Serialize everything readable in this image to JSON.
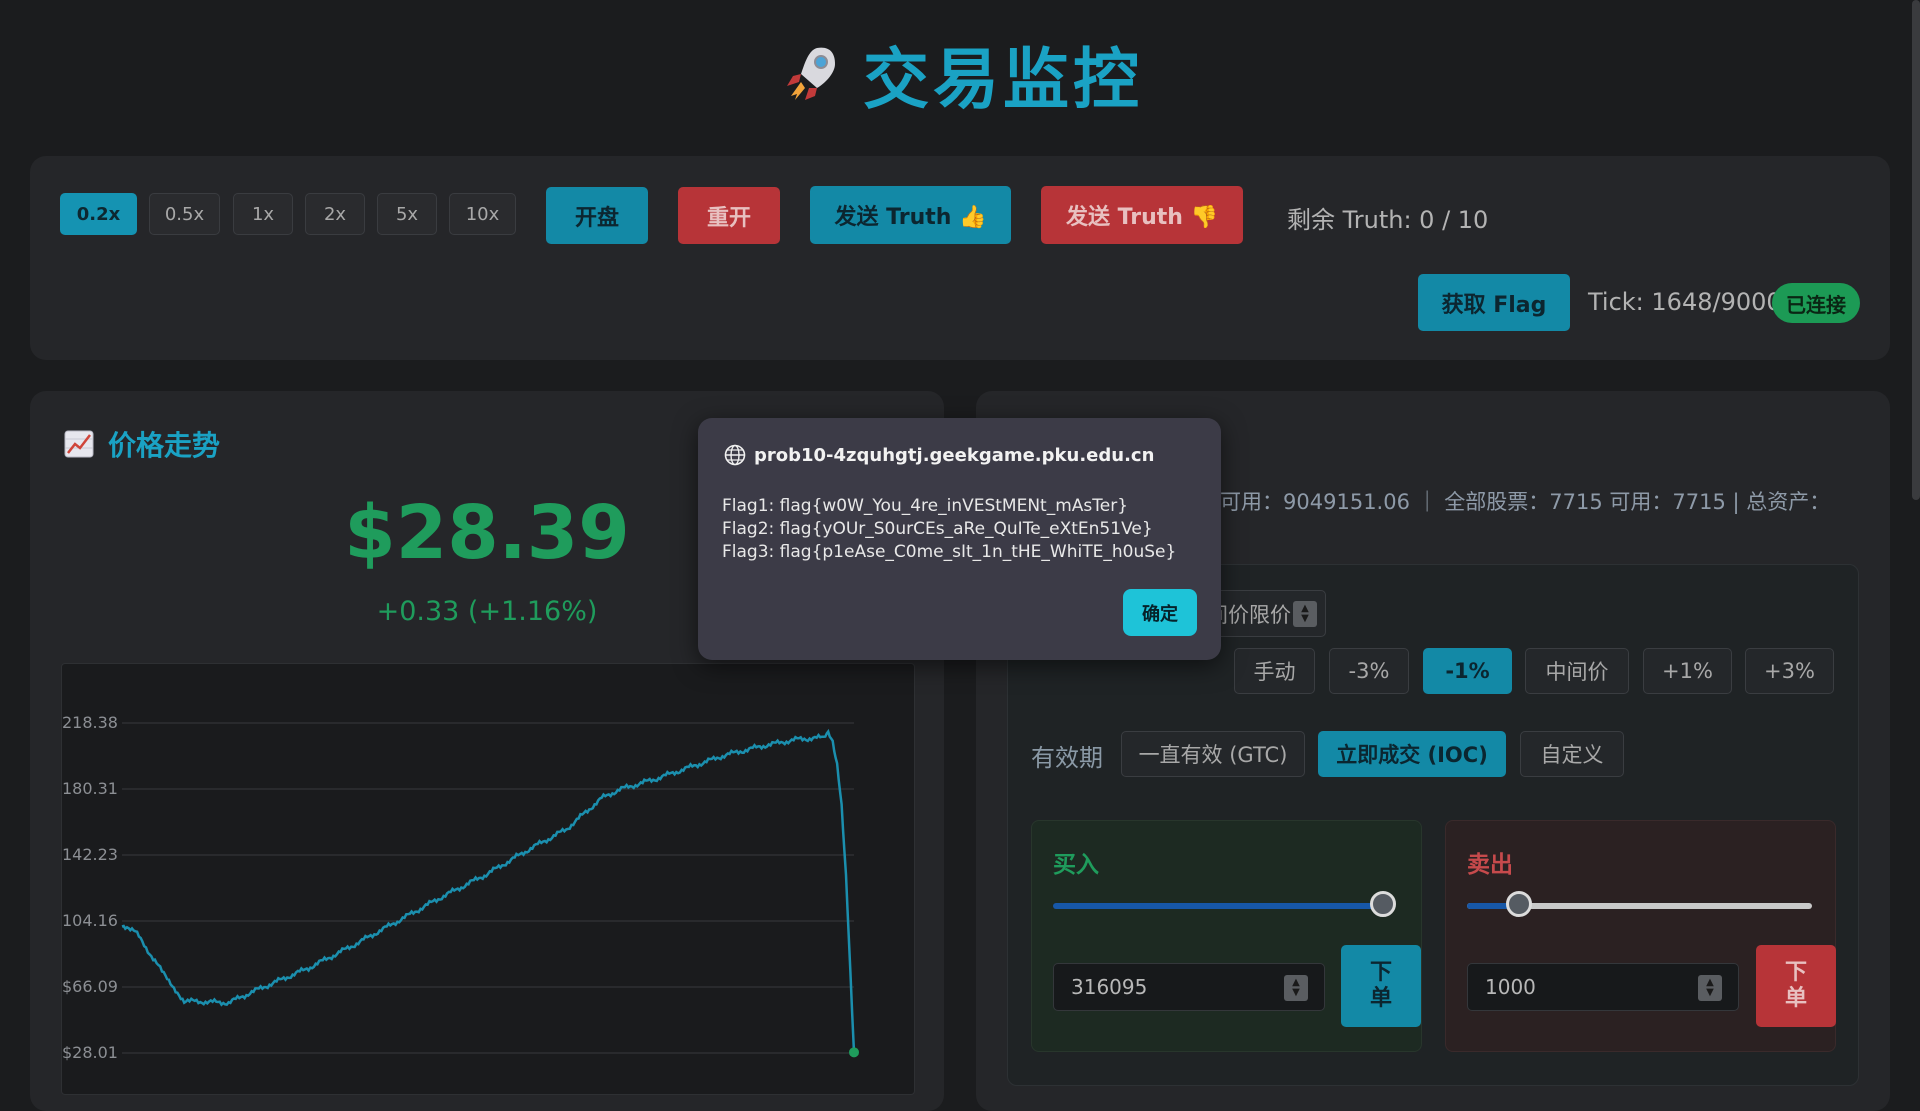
{
  "header": {
    "icon": "rocket-icon",
    "title": "交易监控"
  },
  "controls": {
    "speeds": [
      {
        "label": "0.2x",
        "active": true
      },
      {
        "label": "0.5x",
        "active": false
      },
      {
        "label": "1x",
        "active": false
      },
      {
        "label": "2x",
        "active": false
      },
      {
        "label": "5x",
        "active": false
      },
      {
        "label": "10x",
        "active": false
      }
    ],
    "open_label": "开盘",
    "restart_label": "重开",
    "send_truth_up_label": "发送 Truth 👍",
    "send_truth_down_label": "发送 Truth 👎",
    "remaining_truth": "剩余 Truth: 0 / 10",
    "get_flag_label": "获取 Flag",
    "tick": "Tick: 1648/9000",
    "connection_status": "已连接"
  },
  "price_panel": {
    "title_icon": "chart-icon",
    "title": "价格走势",
    "price": "$28.39",
    "change": "+0.33 (+1.16%)"
  },
  "chart_data": {
    "type": "line",
    "y_ticks": [
      "218.38",
      "180.31",
      "142.23",
      "104.16",
      "$66.09",
      "$28.01"
    ],
    "ylim": [
      28.01,
      218.38
    ],
    "x_range": [
      0,
      1648
    ],
    "series": [
      {
        "color": "#1b8fae",
        "points": [
          [
            0,
            101
          ],
          [
            30,
            98
          ],
          [
            90,
            75
          ],
          [
            140,
            58
          ],
          [
            240,
            57
          ],
          [
            300,
            64
          ],
          [
            420,
            77
          ],
          [
            520,
            90
          ],
          [
            620,
            104
          ],
          [
            720,
            118
          ],
          [
            820,
            131
          ],
          [
            920,
            146
          ],
          [
            1000,
            157
          ],
          [
            1040,
            166
          ],
          [
            1080,
            175
          ],
          [
            1120,
            180
          ],
          [
            1200,
            186
          ],
          [
            1280,
            193
          ],
          [
            1360,
            200
          ],
          [
            1440,
            205
          ],
          [
            1520,
            209
          ],
          [
            1580,
            210
          ],
          [
            1590,
            212
          ],
          [
            1600,
            208
          ],
          [
            1610,
            195
          ],
          [
            1620,
            170
          ],
          [
            1630,
            130
          ],
          [
            1640,
            75
          ],
          [
            1648,
            28.39
          ]
        ]
      }
    ],
    "grid": true
  },
  "account": {
    "text": "5 可用：9049151.06 ｜ 全部股票：7715 可用：7715 | 总资产："
  },
  "order": {
    "type_partial": "间价限价",
    "price_options": [
      {
        "label": "手动",
        "active": false
      },
      {
        "label": "-3%",
        "active": false
      },
      {
        "label": "-1%",
        "active": true
      },
      {
        "label": "中间价",
        "active": false
      },
      {
        "label": "+1%",
        "active": false
      },
      {
        "label": "+3%",
        "active": false
      }
    ],
    "validity_label": "有效期",
    "validity_options": [
      {
        "label": "一直有效 (GTC)",
        "active": false
      },
      {
        "label": "立即成交 (IOC)",
        "active": true
      },
      {
        "label": "自定义",
        "active": false
      }
    ],
    "buy": {
      "label": "买入",
      "slider_value": 1.0,
      "quantity": "316095",
      "submit_label": "下单"
    },
    "sell": {
      "label": "卖出",
      "slider_value": 0.15,
      "quantity": "1000",
      "submit_label": "下单"
    }
  },
  "dialog": {
    "host": "prob10-4zquhgtj.geekgame.pku.edu.cn",
    "lines": [
      "Flag1: flag{w0W_You_4re_inVEStMENt_mAsTer}",
      "Flag2: flag{yOUr_S0urCEs_aRe_QuITe_eXtEn51Ve}",
      "Flag3: flag{p1eAse_C0me_sIt_1n_tHE_WhiTE_h0uSe}"
    ],
    "ok_label": "确定"
  }
}
